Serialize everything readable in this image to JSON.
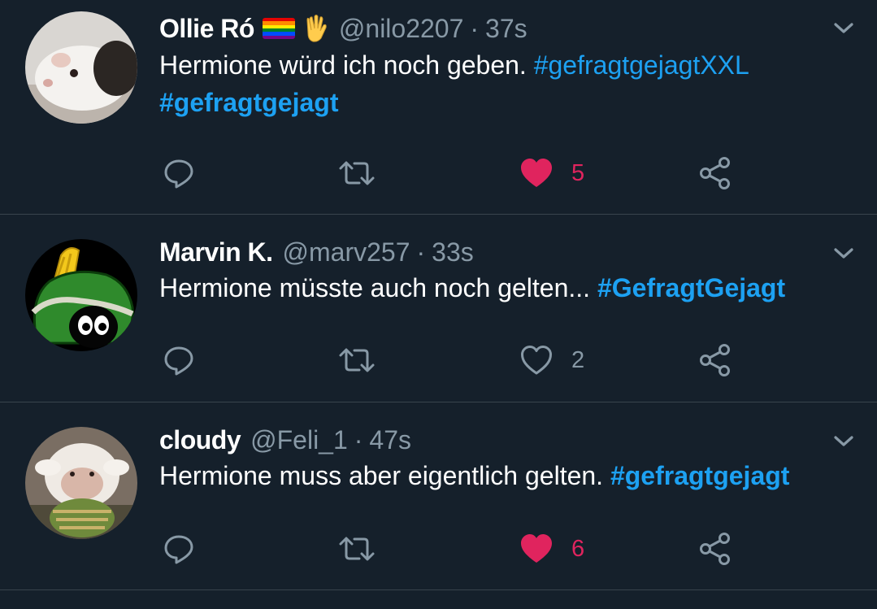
{
  "colors": {
    "background": "#15202b",
    "divider": "#38444d",
    "secondary_text": "#8899a6",
    "link": "#1da1f2",
    "like_active": "#e0245e"
  },
  "tweets": [
    {
      "display_name": "Ollie Ró",
      "emoji": [
        "rainbow-flag",
        "vulcan-salute"
      ],
      "handle": "@nilo2207",
      "separator": "·",
      "time": "37s",
      "text": "Hermione würd ich noch geben.",
      "hashtags": [
        "#gefragtgejagtXXL",
        "#gefragtgejagt"
      ],
      "likes": "5",
      "liked": true,
      "avatar_icon": "guinea-pig-avatar"
    },
    {
      "display_name": "Marvin K.",
      "handle": "@marv257",
      "separator": "·",
      "time": "33s",
      "text": "Hermione müsste auch noch gelten...",
      "hashtags": [
        "#GefragtGejagt"
      ],
      "likes": "2",
      "liked": false,
      "avatar_icon": "marvin-martian-avatar"
    },
    {
      "display_name": "cloudy",
      "handle": "@Feli_1",
      "separator": "·",
      "time": "47s",
      "text": "Hermione muss aber eigentlich gelten.",
      "hashtags": [
        "#gefragtgejagt"
      ],
      "likes": "6",
      "liked": true,
      "avatar_icon": "plush-sheep-avatar"
    }
  ]
}
